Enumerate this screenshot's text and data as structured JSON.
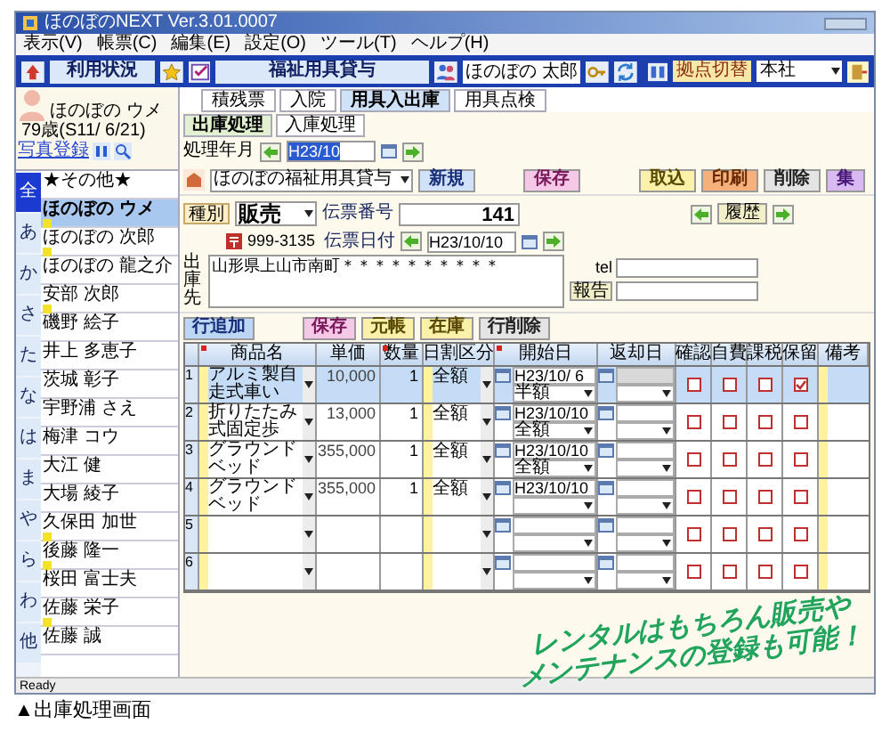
{
  "window": {
    "title": "ほのぼのNEXT Ver.3.01.0007"
  },
  "menu": [
    "表示(V)",
    "帳票(C)",
    "編集(E)",
    "設定(O)",
    "ツール(T)",
    "ヘルプ(H)"
  ],
  "toolbar": {
    "status_button": "利用状況",
    "service": "福祉用具貸与",
    "user": "ほのぼの 太郎",
    "branch_label": "拠点切替",
    "branch": "本社"
  },
  "patient": {
    "name": "ほのぼの ウメ",
    "age": "79歳(S11/ 6/21)",
    "photo_link": "写真登録"
  },
  "index_tabs": [
    {
      "label": "全",
      "selected": true
    },
    {
      "label": "あ",
      "selected": false
    },
    {
      "label": "か",
      "selected": false
    },
    {
      "label": "さ",
      "selected": false
    },
    {
      "label": "た",
      "selected": false
    },
    {
      "label": "な",
      "selected": false
    },
    {
      "label": "は",
      "selected": false
    },
    {
      "label": "ま",
      "selected": false
    },
    {
      "label": "や",
      "selected": false
    },
    {
      "label": "ら",
      "selected": false
    },
    {
      "label": "わ",
      "selected": false
    },
    {
      "label": "他",
      "selected": false
    }
  ],
  "clients": [
    {
      "name": "★その他★",
      "selected": false,
      "marker": false
    },
    {
      "name": "ほのぼの ウメ",
      "selected": true,
      "marker": true
    },
    {
      "name": "ほのぼの 次郎",
      "selected": false,
      "marker": true
    },
    {
      "name": "ほのぼの 龍之介",
      "selected": false,
      "marker": false
    },
    {
      "name": "安部 次郎",
      "selected": false,
      "marker": true
    },
    {
      "name": "磯野 絵子",
      "selected": false,
      "marker": false
    },
    {
      "name": "井上 多恵子",
      "selected": false,
      "marker": false
    },
    {
      "name": "茨城 彰子",
      "selected": false,
      "marker": false
    },
    {
      "name": "宇野浦 さえ",
      "selected": false,
      "marker": false
    },
    {
      "name": "梅津 コウ",
      "selected": false,
      "marker": false
    },
    {
      "name": "大江 健",
      "selected": false,
      "marker": false
    },
    {
      "name": "大場 綾子",
      "selected": false,
      "marker": false
    },
    {
      "name": "久保田 加世",
      "selected": false,
      "marker": true
    },
    {
      "name": "後藤 隆一",
      "selected": false,
      "marker": true
    },
    {
      "name": "桜田 富士夫",
      "selected": false,
      "marker": false
    },
    {
      "name": "佐藤 栄子",
      "selected": false,
      "marker": true
    },
    {
      "name": "佐藤 誠",
      "selected": false,
      "marker": false
    }
  ],
  "tabs": [
    {
      "label": "積残票",
      "selected": false
    },
    {
      "label": "入院",
      "selected": false
    },
    {
      "label": "用具入出庫",
      "selected": true
    },
    {
      "label": "用具点検",
      "selected": false
    }
  ],
  "subtabs": [
    {
      "label": "出庫処理",
      "selected": true
    },
    {
      "label": "入庫処理",
      "selected": false
    }
  ],
  "period": {
    "label": "処理年月",
    "value": "H23/10"
  },
  "actions": {
    "office": "ほのぼの福祉用具貸与",
    "buttons": [
      {
        "label": "新規",
        "kind": "new"
      },
      {
        "label": "保存",
        "kind": "save"
      },
      {
        "label": "取込",
        "kind": "import"
      },
      {
        "label": "印刷",
        "kind": "print"
      },
      {
        "label": "削除",
        "kind": "delete"
      },
      {
        "label": "集",
        "kind": "total"
      }
    ]
  },
  "slip": {
    "type_label": "種別",
    "type": "販売",
    "number_label": "伝票番号",
    "number": "141",
    "date_label": "伝票日付",
    "date": "H23/10/10",
    "history": "履歴",
    "zip": "999-3135",
    "dest_label": "出庫先",
    "address": "山形県上山市南町＊＊＊＊＊＊＊＊＊＊",
    "tel_label": "tel",
    "report": "報告"
  },
  "row_buttons": [
    {
      "label": "行追加",
      "kind": "add"
    },
    {
      "label": "保存",
      "kind": "save"
    },
    {
      "label": "元帳",
      "kind": "ledger"
    },
    {
      "label": "在庫",
      "kind": "stock"
    },
    {
      "label": "行削除",
      "kind": "delete"
    }
  ],
  "table": {
    "columns": [
      {
        "label": "商品名",
        "required": true
      },
      {
        "label": "単価",
        "required": false
      },
      {
        "label": "数量",
        "required": true
      },
      {
        "label": "日割区分",
        "required": false
      },
      {
        "label": "開始日",
        "required": true
      },
      {
        "label": "返却日",
        "required": false
      },
      {
        "label": "確認",
        "required": false
      },
      {
        "label": "自費",
        "required": false
      },
      {
        "label": "課税",
        "required": false
      },
      {
        "label": "保留",
        "required": false
      },
      {
        "label": "備考",
        "required": false
      }
    ],
    "rows": [
      {
        "no": "1",
        "product": "アルミ製自走式車い",
        "price": "10,000",
        "qty": "1",
        "daily": "全額",
        "start": "H23/10/ 6",
        "start_mode": "半額",
        "checks": [
          false,
          false,
          false,
          true
        ],
        "selected": true
      },
      {
        "no": "2",
        "product": "折りたたみ式固定歩",
        "price": "13,000",
        "qty": "1",
        "daily": "全額",
        "start": "H23/10/10",
        "start_mode": "全額",
        "checks": [
          false,
          false,
          false,
          false
        ],
        "selected": false
      },
      {
        "no": "3",
        "product": "グラウンドベッド",
        "price": "355,000",
        "qty": "1",
        "daily": "全額",
        "start": "H23/10/10",
        "start_mode": "全額",
        "checks": [
          false,
          false,
          false,
          false
        ],
        "selected": false
      },
      {
        "no": "4",
        "product": "グラウンドベッド",
        "price": "355,000",
        "qty": "1",
        "daily": "全額",
        "start": "H23/10/10",
        "checks": [
          false,
          false,
          false,
          false
        ],
        "selected": false
      },
      {
        "no": "5",
        "checks": [
          false,
          false,
          false,
          false
        ],
        "selected": false
      },
      {
        "no": "6",
        "checks": [
          false,
          false,
          false,
          false
        ],
        "selected": false
      }
    ]
  },
  "promo": [
    "レンタルはもちろん販売や",
    "メンテナンスの登録も可能！"
  ],
  "status_bar": "Ready",
  "caption": "▲出庫処理画面"
}
